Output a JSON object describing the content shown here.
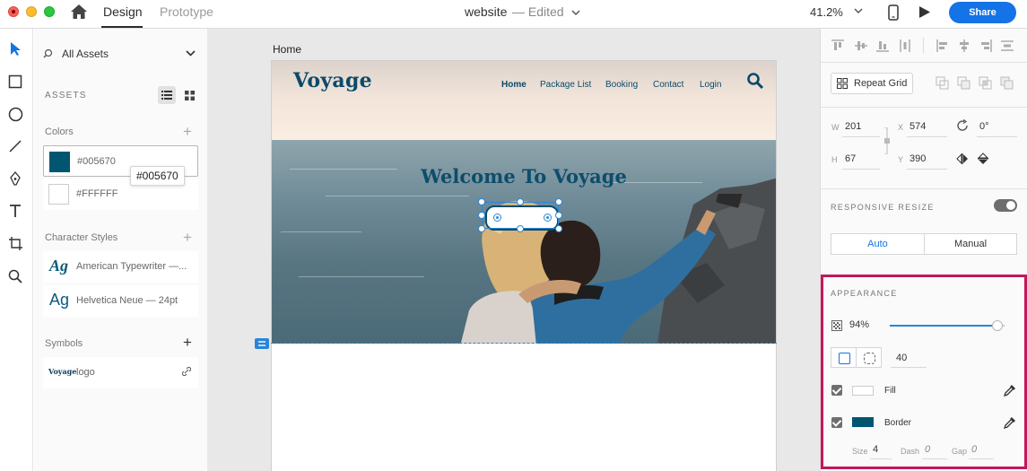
{
  "titlebar": {
    "tabs": {
      "design": "Design",
      "prototype": "Prototype"
    },
    "doc_name": "website",
    "doc_status": "— Edited",
    "zoom": "41.2%",
    "share_label": "Share"
  },
  "assets": {
    "header": "All Assets",
    "section_title": "ASSETS",
    "colors_label": "Colors",
    "colors": [
      {
        "hex": "#005670",
        "label": "#005670"
      },
      {
        "hex": "#FFFFFF",
        "label": "#FFFFFF"
      }
    ],
    "tooltip": "#005670",
    "char_styles_label": "Character Styles",
    "char_styles": [
      {
        "glyph": "Ag",
        "label": "American Typewriter —..."
      },
      {
        "glyph": "Ag",
        "label": "Helvetica Neue — 24pt"
      }
    ],
    "symbols_label": "Symbols",
    "symbols": [
      {
        "thumb": "Voyage",
        "label": "logo"
      }
    ]
  },
  "canvas": {
    "artboard_name": "Home",
    "site": {
      "logo": "Voyage",
      "nav": [
        "Home",
        "Package List",
        "Booking",
        "Contact",
        "Login"
      ],
      "headline": "Welcome To Voyage"
    }
  },
  "inspector": {
    "repeat_grid": "Repeat Grid",
    "w_label": "W",
    "w": "201",
    "x_label": "X",
    "x": "574",
    "h_label": "H",
    "h": "67",
    "y_label": "Y",
    "y": "390",
    "rotation": "0°",
    "responsive_resize": "RESPONSIVE RESIZE",
    "resize_auto": "Auto",
    "resize_manual": "Manual",
    "appearance": "APPEARANCE",
    "opacity": "94%",
    "opacity_value": 0.94,
    "radius": "40",
    "fill_label": "Fill",
    "fill_color": "#FFFFFF",
    "border_label": "Border",
    "border_color": "#005670",
    "size_label": "Size",
    "size": "4",
    "dash_label": "Dash",
    "dash": "0",
    "gap_label": "Gap",
    "gap": "0"
  }
}
